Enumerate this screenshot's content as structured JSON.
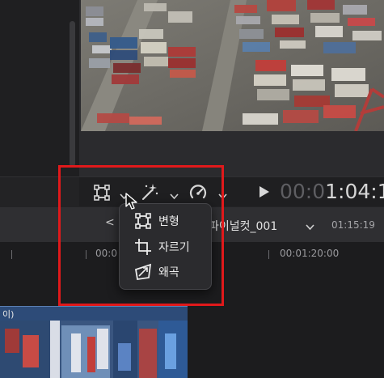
{
  "toolbar": {
    "transform_tool_icon": "transform-icon",
    "effects_tool_icon": "magic-wand-icon",
    "speed_tool_icon": "speedometer-icon",
    "play_icon": "play-icon"
  },
  "timecode": {
    "dim_part": "00:0",
    "bright_part": "1:04:1"
  },
  "timeline": {
    "back_label": "<",
    "project_name": "파이널컷_001",
    "project_duration": "01:15:19",
    "ruler_labels": [
      "00:0",
      "00:01:20:00"
    ],
    "clip_label": "이)"
  },
  "menu": {
    "items": [
      {
        "label": "변형",
        "icon": "transform-icon"
      },
      {
        "label": "자르기",
        "icon": "crop-icon"
      },
      {
        "label": "왜곡",
        "icon": "distort-icon"
      }
    ]
  },
  "colors": {
    "highlight": "#e0191b",
    "accent_clip": "#2d4b78",
    "background": "#232325"
  }
}
